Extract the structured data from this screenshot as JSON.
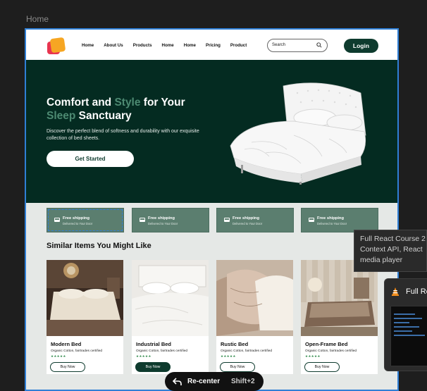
{
  "frame_label": "Home",
  "nav": {
    "links": [
      "Home",
      "About Us",
      "Products",
      "Home",
      "Home",
      "Pricing",
      "Product"
    ],
    "search_placeholder": "Search",
    "login_label": "Login"
  },
  "hero": {
    "title_part1": "Comfort and ",
    "title_accent1": "Style",
    "title_part2": " for Your ",
    "title_accent2": "Sleep",
    "title_part3": " Sanctuary",
    "description": "Discover the perfect blend of softness and durability with our exquisite collection of bed sheets.",
    "cta_label": "Get Started"
  },
  "shipping": [
    {
      "title": "Free shipping",
      "subtitle": "Delivered to Your Door"
    },
    {
      "title": "Free shipping",
      "subtitle": "Delivered to Your Door"
    },
    {
      "title": "Free shipping",
      "subtitle": "Delivered to Your Door"
    },
    {
      "title": "Free shipping",
      "subtitle": "Delivered to Your Door"
    }
  ],
  "section_title": "Similar Items You Might Like",
  "products": [
    {
      "name": "Modern Bed",
      "desc": "Organic Cotton, fairtrades certified",
      "rating": 5,
      "buy_label": "Buy Now"
    },
    {
      "name": "Industrial Bed",
      "desc": "Organic Cotton, fairtrades certified",
      "rating": 5,
      "buy_label": "Buy Now"
    },
    {
      "name": "Rustic Bed",
      "desc": "Organic Cotton, fairtrades certified",
      "rating": 5,
      "buy_label": "Buy Now"
    },
    {
      "name": "Open-Frame Bed",
      "desc": "Organic Cotton, fairtrades certified",
      "rating": 5,
      "buy_label": "Buy Now"
    }
  ],
  "recenter": {
    "label": "Re-center",
    "shortcut": "Shift+2"
  },
  "tooltip": {
    "line1": "Full React Course 2",
    "line2": "Context API, React",
    "line3": "media player"
  },
  "vlc": {
    "title": "Full Re"
  },
  "colors": {
    "brand_dark": "#0e3b2e",
    "hero_bg": "#042b21",
    "accent": "#4d8a72",
    "shipping_bg": "#5b7e6f",
    "selection": "#2f7fd6"
  }
}
